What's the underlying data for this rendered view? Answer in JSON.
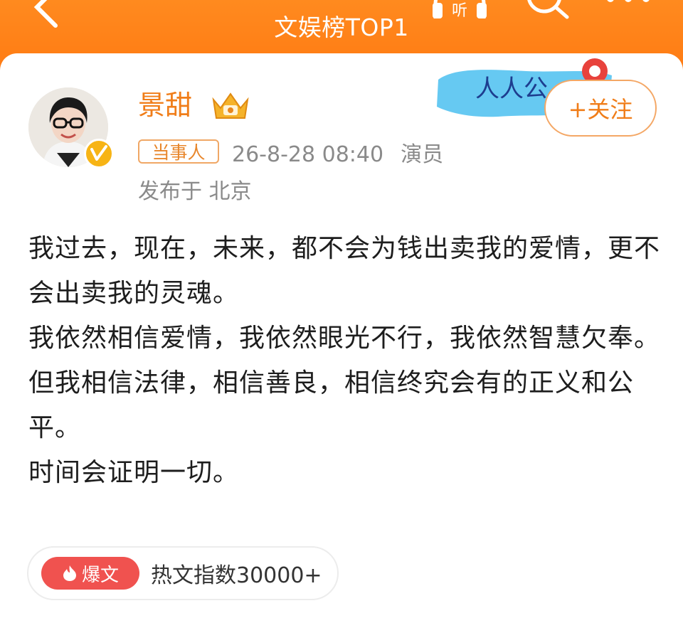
{
  "header": {
    "title": "文娱榜TOP1",
    "listen_label": "听",
    "icons": [
      "back-icon",
      "listen-icon",
      "search-icon",
      "more-icon"
    ]
  },
  "post": {
    "author": "景甜",
    "follow_label": "+关注",
    "role_tag": "当事人",
    "timestamp": "26-8-28 08:40",
    "author_role": "演员",
    "location": "发布于 北京",
    "banner_text": "人人公",
    "paragraphs": [
      "我过去，现在，未来，都不会为钱出卖我的爱情，更不会出卖我的灵魂。",
      "我依然相信爱情，我依然眼光不行，我依然智慧欠奉。",
      "但我相信法律，相信善良，相信终究会有的正义和公平。",
      "时间会证明一切。"
    ],
    "hot_badge": "爆文",
    "hot_index": "热文指数30000+"
  },
  "colors": {
    "brand_orange": "#ff7a12",
    "author_orange": "#f07d19",
    "hot_red": "#f0524f"
  }
}
